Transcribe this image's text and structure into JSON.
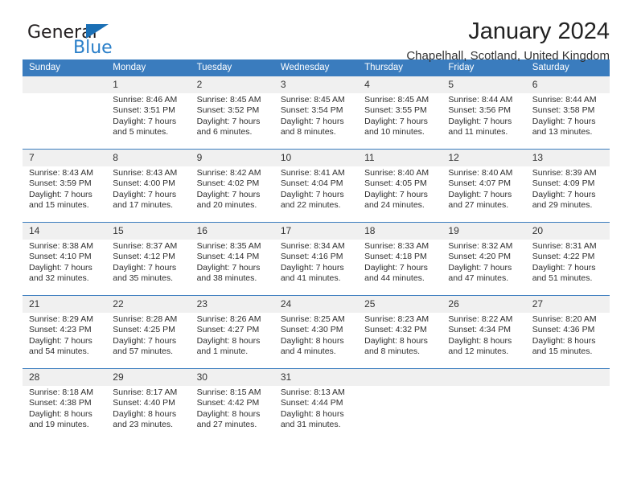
{
  "brand": {
    "name_part1": "General",
    "name_part2": "Blue",
    "triangle_color": "#1a6fb5",
    "blue_color": "#2a7fc9"
  },
  "header": {
    "month_title": "January 2024",
    "location": "Chapelhall, Scotland, United Kingdom"
  },
  "theme": {
    "header_bg": "#3a7cbe",
    "header_text": "#ffffff",
    "daynum_bg": "#f0f0f0",
    "row_divider": "#3a7cbe"
  },
  "calendar": {
    "weekday_headers": [
      "Sunday",
      "Monday",
      "Tuesday",
      "Wednesday",
      "Thursday",
      "Friday",
      "Saturday"
    ],
    "weeks": [
      [
        {
          "day": "",
          "sunrise": "",
          "sunset": "",
          "daylight_line1": "",
          "daylight_line2": ""
        },
        {
          "day": "1",
          "sunrise": "Sunrise: 8:46 AM",
          "sunset": "Sunset: 3:51 PM",
          "daylight_line1": "Daylight: 7 hours",
          "daylight_line2": "and 5 minutes."
        },
        {
          "day": "2",
          "sunrise": "Sunrise: 8:45 AM",
          "sunset": "Sunset: 3:52 PM",
          "daylight_line1": "Daylight: 7 hours",
          "daylight_line2": "and 6 minutes."
        },
        {
          "day": "3",
          "sunrise": "Sunrise: 8:45 AM",
          "sunset": "Sunset: 3:54 PM",
          "daylight_line1": "Daylight: 7 hours",
          "daylight_line2": "and 8 minutes."
        },
        {
          "day": "4",
          "sunrise": "Sunrise: 8:45 AM",
          "sunset": "Sunset: 3:55 PM",
          "daylight_line1": "Daylight: 7 hours",
          "daylight_line2": "and 10 minutes."
        },
        {
          "day": "5",
          "sunrise": "Sunrise: 8:44 AM",
          "sunset": "Sunset: 3:56 PM",
          "daylight_line1": "Daylight: 7 hours",
          "daylight_line2": "and 11 minutes."
        },
        {
          "day": "6",
          "sunrise": "Sunrise: 8:44 AM",
          "sunset": "Sunset: 3:58 PM",
          "daylight_line1": "Daylight: 7 hours",
          "daylight_line2": "and 13 minutes."
        }
      ],
      [
        {
          "day": "7",
          "sunrise": "Sunrise: 8:43 AM",
          "sunset": "Sunset: 3:59 PM",
          "daylight_line1": "Daylight: 7 hours",
          "daylight_line2": "and 15 minutes."
        },
        {
          "day": "8",
          "sunrise": "Sunrise: 8:43 AM",
          "sunset": "Sunset: 4:00 PM",
          "daylight_line1": "Daylight: 7 hours",
          "daylight_line2": "and 17 minutes."
        },
        {
          "day": "9",
          "sunrise": "Sunrise: 8:42 AM",
          "sunset": "Sunset: 4:02 PM",
          "daylight_line1": "Daylight: 7 hours",
          "daylight_line2": "and 20 minutes."
        },
        {
          "day": "10",
          "sunrise": "Sunrise: 8:41 AM",
          "sunset": "Sunset: 4:04 PM",
          "daylight_line1": "Daylight: 7 hours",
          "daylight_line2": "and 22 minutes."
        },
        {
          "day": "11",
          "sunrise": "Sunrise: 8:40 AM",
          "sunset": "Sunset: 4:05 PM",
          "daylight_line1": "Daylight: 7 hours",
          "daylight_line2": "and 24 minutes."
        },
        {
          "day": "12",
          "sunrise": "Sunrise: 8:40 AM",
          "sunset": "Sunset: 4:07 PM",
          "daylight_line1": "Daylight: 7 hours",
          "daylight_line2": "and 27 minutes."
        },
        {
          "day": "13",
          "sunrise": "Sunrise: 8:39 AM",
          "sunset": "Sunset: 4:09 PM",
          "daylight_line1": "Daylight: 7 hours",
          "daylight_line2": "and 29 minutes."
        }
      ],
      [
        {
          "day": "14",
          "sunrise": "Sunrise: 8:38 AM",
          "sunset": "Sunset: 4:10 PM",
          "daylight_line1": "Daylight: 7 hours",
          "daylight_line2": "and 32 minutes."
        },
        {
          "day": "15",
          "sunrise": "Sunrise: 8:37 AM",
          "sunset": "Sunset: 4:12 PM",
          "daylight_line1": "Daylight: 7 hours",
          "daylight_line2": "and 35 minutes."
        },
        {
          "day": "16",
          "sunrise": "Sunrise: 8:35 AM",
          "sunset": "Sunset: 4:14 PM",
          "daylight_line1": "Daylight: 7 hours",
          "daylight_line2": "and 38 minutes."
        },
        {
          "day": "17",
          "sunrise": "Sunrise: 8:34 AM",
          "sunset": "Sunset: 4:16 PM",
          "daylight_line1": "Daylight: 7 hours",
          "daylight_line2": "and 41 minutes."
        },
        {
          "day": "18",
          "sunrise": "Sunrise: 8:33 AM",
          "sunset": "Sunset: 4:18 PM",
          "daylight_line1": "Daylight: 7 hours",
          "daylight_line2": "and 44 minutes."
        },
        {
          "day": "19",
          "sunrise": "Sunrise: 8:32 AM",
          "sunset": "Sunset: 4:20 PM",
          "daylight_line1": "Daylight: 7 hours",
          "daylight_line2": "and 47 minutes."
        },
        {
          "day": "20",
          "sunrise": "Sunrise: 8:31 AM",
          "sunset": "Sunset: 4:22 PM",
          "daylight_line1": "Daylight: 7 hours",
          "daylight_line2": "and 51 minutes."
        }
      ],
      [
        {
          "day": "21",
          "sunrise": "Sunrise: 8:29 AM",
          "sunset": "Sunset: 4:23 PM",
          "daylight_line1": "Daylight: 7 hours",
          "daylight_line2": "and 54 minutes."
        },
        {
          "day": "22",
          "sunrise": "Sunrise: 8:28 AM",
          "sunset": "Sunset: 4:25 PM",
          "daylight_line1": "Daylight: 7 hours",
          "daylight_line2": "and 57 minutes."
        },
        {
          "day": "23",
          "sunrise": "Sunrise: 8:26 AM",
          "sunset": "Sunset: 4:27 PM",
          "daylight_line1": "Daylight: 8 hours",
          "daylight_line2": "and 1 minute."
        },
        {
          "day": "24",
          "sunrise": "Sunrise: 8:25 AM",
          "sunset": "Sunset: 4:30 PM",
          "daylight_line1": "Daylight: 8 hours",
          "daylight_line2": "and 4 minutes."
        },
        {
          "day": "25",
          "sunrise": "Sunrise: 8:23 AM",
          "sunset": "Sunset: 4:32 PM",
          "daylight_line1": "Daylight: 8 hours",
          "daylight_line2": "and 8 minutes."
        },
        {
          "day": "26",
          "sunrise": "Sunrise: 8:22 AM",
          "sunset": "Sunset: 4:34 PM",
          "daylight_line1": "Daylight: 8 hours",
          "daylight_line2": "and 12 minutes."
        },
        {
          "day": "27",
          "sunrise": "Sunrise: 8:20 AM",
          "sunset": "Sunset: 4:36 PM",
          "daylight_line1": "Daylight: 8 hours",
          "daylight_line2": "and 15 minutes."
        }
      ],
      [
        {
          "day": "28",
          "sunrise": "Sunrise: 8:18 AM",
          "sunset": "Sunset: 4:38 PM",
          "daylight_line1": "Daylight: 8 hours",
          "daylight_line2": "and 19 minutes."
        },
        {
          "day": "29",
          "sunrise": "Sunrise: 8:17 AM",
          "sunset": "Sunset: 4:40 PM",
          "daylight_line1": "Daylight: 8 hours",
          "daylight_line2": "and 23 minutes."
        },
        {
          "day": "30",
          "sunrise": "Sunrise: 8:15 AM",
          "sunset": "Sunset: 4:42 PM",
          "daylight_line1": "Daylight: 8 hours",
          "daylight_line2": "and 27 minutes."
        },
        {
          "day": "31",
          "sunrise": "Sunrise: 8:13 AM",
          "sunset": "Sunset: 4:44 PM",
          "daylight_line1": "Daylight: 8 hours",
          "daylight_line2": "and 31 minutes."
        },
        {
          "day": "",
          "sunrise": "",
          "sunset": "",
          "daylight_line1": "",
          "daylight_line2": ""
        },
        {
          "day": "",
          "sunrise": "",
          "sunset": "",
          "daylight_line1": "",
          "daylight_line2": ""
        },
        {
          "day": "",
          "sunrise": "",
          "sunset": "",
          "daylight_line1": "",
          "daylight_line2": ""
        }
      ]
    ]
  }
}
